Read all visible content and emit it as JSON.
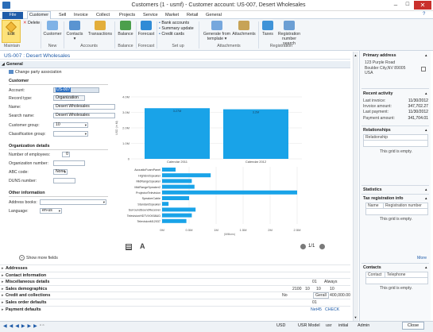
{
  "window": {
    "title": "Customers (1 - usmf) - Customer account: US-007, Desert Wholesales"
  },
  "menu": {
    "file": "File",
    "tabs": [
      "Customer",
      "Sell",
      "Invoice",
      "Collect",
      "Projects",
      "Service",
      "Market",
      "Retail",
      "General"
    ]
  },
  "ribbon": {
    "edit": "Edit",
    "delete": "Delete",
    "customer": "Customer",
    "contacts": "Contacts",
    "transactions": "Transactions",
    "balance": "Balance",
    "forecast": "Forecast",
    "bank_accounts": "Bank accounts",
    "summary_update": "Summary update",
    "credit_cards": "Credit cards",
    "generate_from_template": "Generate from template",
    "attachments": "Attachments",
    "taxes": "Taxes",
    "registration_number_search": "Registration number search",
    "groups": [
      "Maintain",
      "New",
      "Accounts",
      "Balance",
      "Forecast",
      "Set up",
      "Attachments",
      "Registration"
    ]
  },
  "record": {
    "title": "US-007 : Desert Wholesales"
  },
  "general": {
    "header": "General",
    "change_party": "Change party association",
    "customer_section": "Customer",
    "account_label": "Account:",
    "account_value": "US-007",
    "record_type_label": "Record type:",
    "record_type_value": "Organization",
    "name_label": "Name:",
    "name_value": "Desert Wholesales",
    "search_name_label": "Search name:",
    "search_name_value": "Desert Wholesales",
    "customer_group_label": "Customer group:",
    "customer_group_value": "10",
    "classification_group_label": "Classification group:",
    "org_section": "Organization details",
    "employees_label": "Number of employees:",
    "employees_value": "0",
    "org_number_label": "Organization number:",
    "abc_code_label": "ABC code:",
    "abc_code_value": "None",
    "duns_label": "DUNS number:",
    "other_section": "Other information",
    "address_books_label": "Address books:",
    "language_label": "Language:",
    "language_value": "en-us",
    "show_more": "Show more fields"
  },
  "chart_top": {
    "type": "bar",
    "categories": [
      "Calendar 2011",
      "Calendar 2012"
    ],
    "values": [
      3.27,
      3.2
    ],
    "value_labels": [
      "3.27M",
      "3.2M"
    ],
    "ylabel": "USD (in M)",
    "yticks": [
      "0",
      "1.0M",
      "2.0M",
      "3.0M",
      "4.0M"
    ],
    "ylim": [
      0,
      4
    ]
  },
  "chart_data": [
    {
      "type": "bar",
      "categories": [
        "Calendar 2011",
        "Calendar 2012"
      ],
      "values": [
        3.27,
        3.2
      ],
      "ylim": [
        0,
        4
      ]
    },
    {
      "type": "bar",
      "orientation": "horizontal",
      "categories": [
        "AcousticFoamPanel",
        "HighEndSpeaker",
        "MidRangeSpeaker",
        "MidRangeSpeaker2",
        "ProjectorTelevision",
        "SpeakerCable",
        "StandardSpeaker",
        "SurroundSoundReceiver",
        "TelevisionHDTVX0938UD",
        "TelevisionM12037"
      ],
      "values": [
        0.25,
        0.9,
        0.55,
        0.6,
        2.7,
        0.5,
        0.12,
        0.62,
        0.55,
        0.45
      ],
      "xticks": [
        "0M",
        "0.5M",
        "1M",
        "1.5M",
        "2M",
        "2.5M"
      ],
      "xlabel": "(Millions)",
      "xlim": [
        0,
        2.5
      ]
    }
  ],
  "chart_bottom": {
    "categories": [
      "AcousticFoamPanel",
      "HighEndSpeaker",
      "MidRangeSpeaker",
      "MidRangeSpeaker2",
      "ProjectorTelevision",
      "SpeakerCable",
      "StandardSpeaker",
      "SurroundSoundReceiver",
      "TelevisionHDTVX0938UD",
      "TelevisionM12037"
    ],
    "values": [
      0.25,
      0.9,
      0.55,
      0.6,
      2.7,
      0.5,
      0.12,
      0.62,
      0.55,
      0.45
    ],
    "xticks": [
      "0M",
      "0.5M",
      "1M",
      "1.5M",
      "2M",
      "2.5M"
    ],
    "xlabel": "(Millions)",
    "xlim": [
      0,
      2.5
    ],
    "pager": "1/1"
  },
  "fasttabs": [
    {
      "label": "Addresses",
      "extra": []
    },
    {
      "label": "Contact information",
      "extra": []
    },
    {
      "label": "Miscellaneous details",
      "extra": [
        "01",
        "Always"
      ]
    },
    {
      "label": "Sales demographics",
      "extra": [
        "2100",
        "10",
        "10",
        "10"
      ]
    },
    {
      "label": "Credit and collections",
      "extra": [
        "No",
        "Gerall",
        "400,000.00"
      ]
    },
    {
      "label": "Sales order defaults",
      "extra": [
        "01"
      ]
    },
    {
      "label": "Payment defaults",
      "extra": [
        "Net45",
        "CHECK"
      ]
    }
  ],
  "factbox": {
    "primary_address": {
      "title": "Primary address",
      "lines": [
        "123 Purple Road",
        "Boulder City,NV 89005",
        "USA"
      ]
    },
    "recent_activity": {
      "title": "Recent activity",
      "rows": [
        {
          "label": "Last invoice:",
          "value": "11/30/2012"
        },
        {
          "label": "Invoice amount:",
          "value": "347,702.27"
        },
        {
          "label": "Last payment:",
          "value": "11/30/2012"
        },
        {
          "label": "Payment amount:",
          "value": "341,704.01"
        }
      ]
    },
    "relationships": {
      "title": "Relationships",
      "column": "Relationship",
      "empty": "This grid is empty."
    },
    "statistics": {
      "title": "Statistics"
    },
    "tax_info": {
      "title": "Tax registration info",
      "columns": [
        "Name",
        "Registration number"
      ],
      "empty": "This grid is empty."
    },
    "more": "More",
    "contacts": {
      "title": "Contacts",
      "columns": [
        "Contact",
        "Telephone"
      ],
      "empty": "This grid is empty."
    }
  },
  "status": {
    "usd": "USD",
    "model": "USR Model",
    "company": "usr",
    "partition": "initial",
    "user": "Admin",
    "close": "Close"
  }
}
